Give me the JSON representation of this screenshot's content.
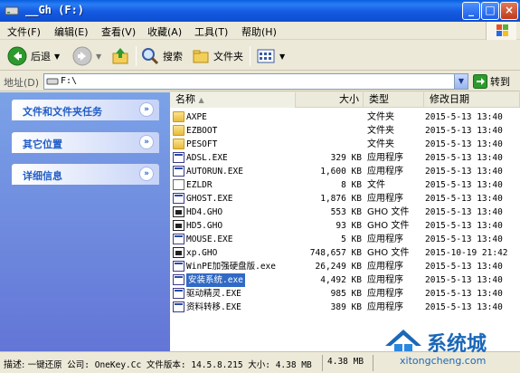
{
  "window": {
    "title": "__Gh (F:)",
    "minimize": "_",
    "maximize": "□",
    "close": "×"
  },
  "menu": [
    "文件(F)",
    "编辑(E)",
    "查看(V)",
    "收藏(A)",
    "工具(T)",
    "帮助(H)"
  ],
  "toolbar": {
    "back": "后退",
    "search": "搜索",
    "folders": "文件夹"
  },
  "address": {
    "label": "地址(D)",
    "path": "F:\\",
    "go": "转到"
  },
  "taskpane": {
    "groups": [
      "文件和文件夹任务",
      "其它位置",
      "详细信息"
    ]
  },
  "columns": {
    "name": "名称",
    "size": "大小",
    "type": "类型",
    "modified": "修改日期"
  },
  "files": [
    {
      "name": "AXPE",
      "size": "",
      "type": "文件夹",
      "date": "2015-5-13 13:40",
      "icon": "folder-icon"
    },
    {
      "name": "EZBOOT",
      "size": "",
      "type": "文件夹",
      "date": "2015-5-13 13:40",
      "icon": "folder-icon"
    },
    {
      "name": "PESOFT",
      "size": "",
      "type": "文件夹",
      "date": "2015-5-13 13:40",
      "icon": "folder-icon"
    },
    {
      "name": "ADSL.EXE",
      "size": "329 KB",
      "type": "应用程序",
      "date": "2015-5-13 13:40",
      "icon": "network-icon"
    },
    {
      "name": "AUTORUN.EXE",
      "size": "1,600 KB",
      "type": "应用程序",
      "date": "2015-5-13 13:40",
      "icon": "disc-icon"
    },
    {
      "name": "EZLDR",
      "size": "8 KB",
      "type": "文件",
      "date": "2015-5-13 13:40",
      "icon": "file-icon"
    },
    {
      "name": "GHOST.EXE",
      "size": "1,876 KB",
      "type": "应用程序",
      "date": "2015-5-13 13:40",
      "icon": "exe-icon"
    },
    {
      "name": "HD4.GHO",
      "size": "553 KB",
      "type": "GHO 文件",
      "date": "2015-5-13 13:40",
      "icon": "ghost-file-icon"
    },
    {
      "name": "HD5.GHO",
      "size": "93 KB",
      "type": "GHO 文件",
      "date": "2015-5-13 13:40",
      "icon": "ghost-file-icon"
    },
    {
      "name": "MOUSE.EXE",
      "size": "5 KB",
      "type": "应用程序",
      "date": "2015-5-13 13:40",
      "icon": "exe-icon"
    },
    {
      "name": "xp.GHO",
      "size": "748,657 KB",
      "type": "GHO 文件",
      "date": "2015-10-19 21:42",
      "icon": "ghost-file-icon"
    },
    {
      "name": "WinPE加强硬盘版.exe",
      "size": "26,249 KB",
      "type": "应用程序",
      "date": "2015-5-13 13:40",
      "icon": "winpe-icon"
    },
    {
      "name": "安装系统.exe",
      "size": "4,492 KB",
      "type": "应用程序",
      "date": "2015-5-13 13:40",
      "icon": "install-icon",
      "selected": true
    },
    {
      "name": "驱动精灵.EXE",
      "size": "985 KB",
      "type": "应用程序",
      "date": "2015-5-13 13:40",
      "icon": "driver-icon"
    },
    {
      "name": "资料转移.EXE",
      "size": "389 KB",
      "type": "应用程序",
      "date": "2015-5-13 13:40",
      "icon": "transfer-icon"
    }
  ],
  "status": {
    "desc_label": "描述:",
    "desc": "一键还原 公司: OneKey.Cc 文件版本: 14.5.8.215 大小: 4.38 MB",
    "size": "4.38 MB"
  },
  "watermark": {
    "text": "系统城",
    "url": "xitongcheng.com"
  }
}
